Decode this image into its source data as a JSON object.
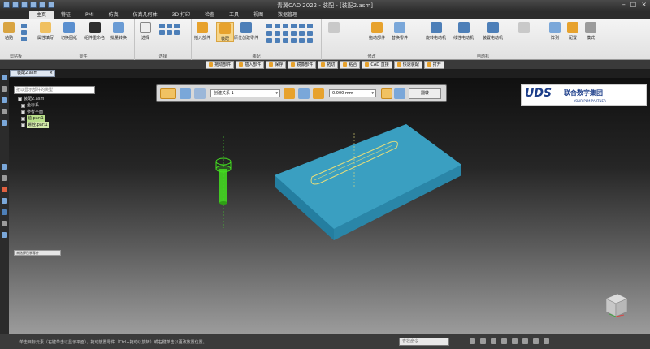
{
  "window": {
    "title": "青翼CAD 2022 - 装配 - [装配2.asm]"
  },
  "tabs": [
    "主页",
    "特征",
    "PMI",
    "仿真",
    "仿真几何体",
    "3D 打印",
    "检查",
    "工具",
    "视图",
    "数据管理"
  ],
  "ribbon": {
    "groups": [
      {
        "label": "剪贴板",
        "buttons": [
          "粘贴"
        ]
      },
      {
        "label": "零件",
        "buttons": [
          "属性填写",
          "切换图纸",
          "组件重命名",
          "批量转换"
        ]
      },
      {
        "label": "选择",
        "buttons": [
          "选择"
        ]
      },
      {
        "label": "装配",
        "buttons": [
          "插入部件",
          "装配",
          "原位创建零件"
        ]
      },
      {
        "label": "修改",
        "buttons": [
          "拖动部件",
          "替换零件"
        ]
      },
      {
        "label": "电动机",
        "buttons": [
          "旋转电动机",
          "线性电动机",
          "装置电动机"
        ]
      },
      {
        "label": "",
        "buttons": [
          "阵列",
          "配置",
          "模式"
        ]
      }
    ]
  },
  "cmdbar": [
    "拖动部件",
    "插入部件",
    "保存",
    "镜像部件",
    "拓切",
    "粘合",
    "CAD 直接",
    "快速装配",
    "打开"
  ],
  "doc_tab": {
    "label": "装配2.asm",
    "close": "×"
  },
  "pathfinder": {
    "filter_placeholder": "按以显示部件的类型",
    "items": [
      {
        "label": "装配2.asm",
        "style": "plain"
      },
      {
        "label": "坐标系",
        "style": "plain"
      },
      {
        "label": "参考平面",
        "style": "plain"
      },
      {
        "label": "轴.par:1",
        "style": "hl"
      },
      {
        "label": "螺栓.par:1",
        "style": "hl2"
      }
    ],
    "bottom_tab": "未选择已装零件"
  },
  "command_toolbar": {
    "relation_select": "创建关系 1",
    "offset_value": "0.000 mm",
    "flip_label": "翻转"
  },
  "logo": {
    "mark": "UDS",
    "cn": "联合数字集团",
    "en": "YOUR PLM PARTNER"
  },
  "status": {
    "message": "单击目标元素（右键单击以显示平面），拖动放置零件（Ctrl+拖动以旋转）或右键单击以更改放置位置。",
    "find_placeholder": "查找命令"
  },
  "colors": {
    "plate": "#3a9fc1",
    "accent": "#e7a22d",
    "bolt": "#44e020"
  }
}
